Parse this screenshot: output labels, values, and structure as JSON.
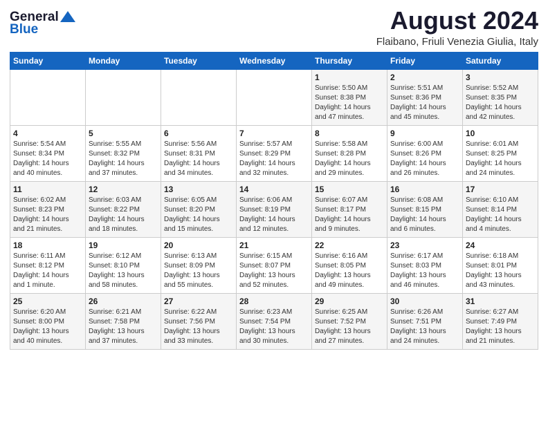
{
  "logo": {
    "general": "General",
    "blue": "Blue"
  },
  "title": "August 2024",
  "subtitle": "Flaibano, Friuli Venezia Giulia, Italy",
  "headers": [
    "Sunday",
    "Monday",
    "Tuesday",
    "Wednesday",
    "Thursday",
    "Friday",
    "Saturday"
  ],
  "weeks": [
    [
      {
        "day": "",
        "info": ""
      },
      {
        "day": "",
        "info": ""
      },
      {
        "day": "",
        "info": ""
      },
      {
        "day": "",
        "info": ""
      },
      {
        "day": "1",
        "info": "Sunrise: 5:50 AM\nSunset: 8:38 PM\nDaylight: 14 hours\nand 47 minutes."
      },
      {
        "day": "2",
        "info": "Sunrise: 5:51 AM\nSunset: 8:36 PM\nDaylight: 14 hours\nand 45 minutes."
      },
      {
        "day": "3",
        "info": "Sunrise: 5:52 AM\nSunset: 8:35 PM\nDaylight: 14 hours\nand 42 minutes."
      }
    ],
    [
      {
        "day": "4",
        "info": "Sunrise: 5:54 AM\nSunset: 8:34 PM\nDaylight: 14 hours\nand 40 minutes."
      },
      {
        "day": "5",
        "info": "Sunrise: 5:55 AM\nSunset: 8:32 PM\nDaylight: 14 hours\nand 37 minutes."
      },
      {
        "day": "6",
        "info": "Sunrise: 5:56 AM\nSunset: 8:31 PM\nDaylight: 14 hours\nand 34 minutes."
      },
      {
        "day": "7",
        "info": "Sunrise: 5:57 AM\nSunset: 8:29 PM\nDaylight: 14 hours\nand 32 minutes."
      },
      {
        "day": "8",
        "info": "Sunrise: 5:58 AM\nSunset: 8:28 PM\nDaylight: 14 hours\nand 29 minutes."
      },
      {
        "day": "9",
        "info": "Sunrise: 6:00 AM\nSunset: 8:26 PM\nDaylight: 14 hours\nand 26 minutes."
      },
      {
        "day": "10",
        "info": "Sunrise: 6:01 AM\nSunset: 8:25 PM\nDaylight: 14 hours\nand 24 minutes."
      }
    ],
    [
      {
        "day": "11",
        "info": "Sunrise: 6:02 AM\nSunset: 8:23 PM\nDaylight: 14 hours\nand 21 minutes."
      },
      {
        "day": "12",
        "info": "Sunrise: 6:03 AM\nSunset: 8:22 PM\nDaylight: 14 hours\nand 18 minutes."
      },
      {
        "day": "13",
        "info": "Sunrise: 6:05 AM\nSunset: 8:20 PM\nDaylight: 14 hours\nand 15 minutes."
      },
      {
        "day": "14",
        "info": "Sunrise: 6:06 AM\nSunset: 8:19 PM\nDaylight: 14 hours\nand 12 minutes."
      },
      {
        "day": "15",
        "info": "Sunrise: 6:07 AM\nSunset: 8:17 PM\nDaylight: 14 hours\nand 9 minutes."
      },
      {
        "day": "16",
        "info": "Sunrise: 6:08 AM\nSunset: 8:15 PM\nDaylight: 14 hours\nand 6 minutes."
      },
      {
        "day": "17",
        "info": "Sunrise: 6:10 AM\nSunset: 8:14 PM\nDaylight: 14 hours\nand 4 minutes."
      }
    ],
    [
      {
        "day": "18",
        "info": "Sunrise: 6:11 AM\nSunset: 8:12 PM\nDaylight: 14 hours\nand 1 minute."
      },
      {
        "day": "19",
        "info": "Sunrise: 6:12 AM\nSunset: 8:10 PM\nDaylight: 13 hours\nand 58 minutes."
      },
      {
        "day": "20",
        "info": "Sunrise: 6:13 AM\nSunset: 8:09 PM\nDaylight: 13 hours\nand 55 minutes."
      },
      {
        "day": "21",
        "info": "Sunrise: 6:15 AM\nSunset: 8:07 PM\nDaylight: 13 hours\nand 52 minutes."
      },
      {
        "day": "22",
        "info": "Sunrise: 6:16 AM\nSunset: 8:05 PM\nDaylight: 13 hours\nand 49 minutes."
      },
      {
        "day": "23",
        "info": "Sunrise: 6:17 AM\nSunset: 8:03 PM\nDaylight: 13 hours\nand 46 minutes."
      },
      {
        "day": "24",
        "info": "Sunrise: 6:18 AM\nSunset: 8:01 PM\nDaylight: 13 hours\nand 43 minutes."
      }
    ],
    [
      {
        "day": "25",
        "info": "Sunrise: 6:20 AM\nSunset: 8:00 PM\nDaylight: 13 hours\nand 40 minutes."
      },
      {
        "day": "26",
        "info": "Sunrise: 6:21 AM\nSunset: 7:58 PM\nDaylight: 13 hours\nand 37 minutes."
      },
      {
        "day": "27",
        "info": "Sunrise: 6:22 AM\nSunset: 7:56 PM\nDaylight: 13 hours\nand 33 minutes."
      },
      {
        "day": "28",
        "info": "Sunrise: 6:23 AM\nSunset: 7:54 PM\nDaylight: 13 hours\nand 30 minutes."
      },
      {
        "day": "29",
        "info": "Sunrise: 6:25 AM\nSunset: 7:52 PM\nDaylight: 13 hours\nand 27 minutes."
      },
      {
        "day": "30",
        "info": "Sunrise: 6:26 AM\nSunset: 7:51 PM\nDaylight: 13 hours\nand 24 minutes."
      },
      {
        "day": "31",
        "info": "Sunrise: 6:27 AM\nSunset: 7:49 PM\nDaylight: 13 hours\nand 21 minutes."
      }
    ]
  ]
}
